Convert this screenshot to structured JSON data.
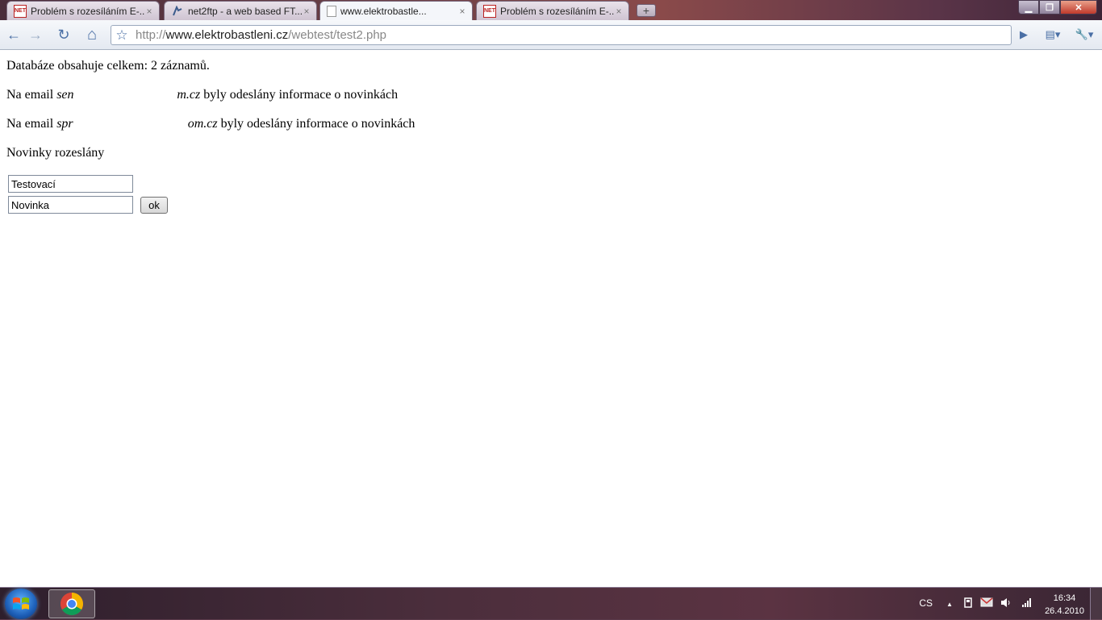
{
  "tabs": [
    {
      "title": "Problém s rozesíláním E-...",
      "icon": "net-icon",
      "active": false
    },
    {
      "title": "net2ftp - a web based FT...",
      "icon": "ftp-icon",
      "active": false
    },
    {
      "title": "www.elektrobastle...",
      "icon": "blank-page-icon",
      "active": true
    },
    {
      "title": "Problém s rozesíláním E-...",
      "icon": "net-icon",
      "active": false
    }
  ],
  "tab_close_glyph": "×",
  "new_tab_glyph": "+",
  "window_controls": {
    "minimize": "▁",
    "maximize": "❐",
    "close": "✕"
  },
  "toolbar": {
    "back_glyph": "←",
    "forward_glyph": "→",
    "reload_glyph": "↻",
    "home_glyph": "⌂",
    "star_glyph": "☆",
    "go_glyph": "▶",
    "page_menu_glyph": "▤▾",
    "tools_menu_glyph": "🔧▾"
  },
  "address_bar": {
    "scheme": "http://",
    "host": "www.elektrobastleni.cz",
    "path": "/webtest/test2.php"
  },
  "page": {
    "count_line": "Databáze obsahuje celkem: 2 záznamů.",
    "email_lines": [
      {
        "prefix": "Na email ",
        "email_start": "sen",
        "email_end": "m.cz",
        "suffix": " byly odeslány informace o novinkách"
      },
      {
        "prefix": "Na email ",
        "email_start": "spr",
        "email_end": "om.cz",
        "suffix": " byly odeslány informace o novinkách"
      }
    ],
    "sent_line": "Novinky rozeslány",
    "form": {
      "title_value": "Testovací",
      "body_value": "Novinka",
      "submit_label": "ok"
    }
  },
  "taskbar": {
    "language": "CS",
    "tray_up_glyph": "▲",
    "time": "16:34",
    "date": "26.4.2010"
  },
  "colors": {
    "accent": "#4a6fa5",
    "page_background": "#ffffff"
  }
}
